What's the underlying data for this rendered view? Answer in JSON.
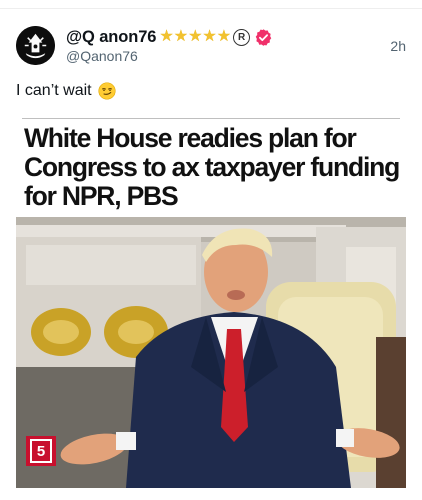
{
  "tweet": {
    "display_name": "@Q anon76",
    "star_icon": "star-icon",
    "stars": 5,
    "registered_mark": "R",
    "handle": "@Qanon76",
    "timestamp": "2h",
    "text": "I can’t wait",
    "emoji": "smirking-face-emoji",
    "verified_color": "#f0306a"
  },
  "media": {
    "headline": "White House readies plan for Congress to ax taxpayer funding for NPR, PBS",
    "logo_text": "5",
    "logo_color": "#c8102e"
  }
}
